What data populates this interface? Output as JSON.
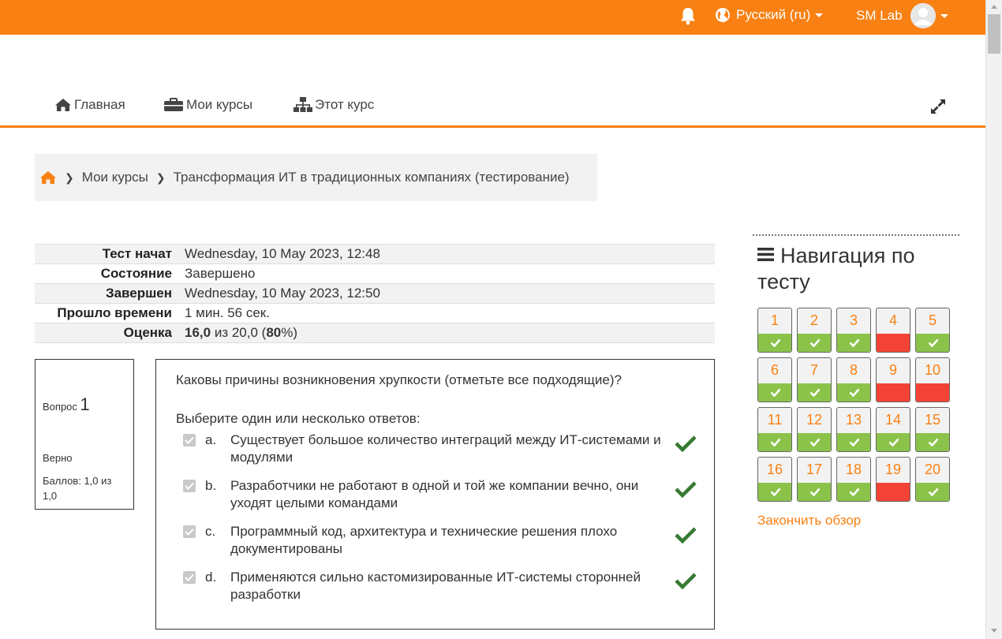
{
  "header": {
    "language": "Русский (ru)",
    "user_name": "SM Lab"
  },
  "nav": {
    "home": "Главная",
    "my_courses": "Мои курсы",
    "this_course": "Этот курс"
  },
  "breadcrumb": {
    "my_courses": "Мои курсы",
    "course": "Трансформация ИТ в традиционных компаниях (тестирование)"
  },
  "summary": {
    "started_label": "Тест начат",
    "started_value": "Wednesday, 10 May 2023, 12:48",
    "state_label": "Состояние",
    "state_value": "Завершено",
    "completed_label": "Завершен",
    "completed_value": "Wednesday, 10 May 2023, 12:50",
    "elapsed_label": "Прошло времени",
    "elapsed_value": "1 мин. 56 сек.",
    "grade_label": "Оценка",
    "grade_score": "16,0",
    "grade_rest_a": " из 20,0 (",
    "grade_percent": "80",
    "grade_rest_b": "%)"
  },
  "question": {
    "label": "Вопрос",
    "number": "1",
    "state": "Верно",
    "grade": "Баллов: 1,0 из 1,0",
    "text": "Каковы причины возникновения хрупкости (отметьте все подходящие)?",
    "prompt": "Выберите один или несколько ответов:",
    "answers": [
      {
        "letter": "a.",
        "text": "Существует большое количество интеграций между ИТ-системами и модулями"
      },
      {
        "letter": "b.",
        "text": "Разработчики не работают в одной и той же компании вечно, они уходят целыми командами"
      },
      {
        "letter": "c.",
        "text": "Программный код, архитектура и технические решения плохо документированы"
      },
      {
        "letter": "d.",
        "text": "Применяются сильно кастомизированные ИТ-системы сторонней разработки"
      }
    ]
  },
  "quiz_nav": {
    "title": "Навигация по тесту",
    "finish_review": "Закончить обзор",
    "items": [
      {
        "num": "1",
        "status": "correct"
      },
      {
        "num": "2",
        "status": "correct"
      },
      {
        "num": "3",
        "status": "correct"
      },
      {
        "num": "4",
        "status": "incorrect"
      },
      {
        "num": "5",
        "status": "correct"
      },
      {
        "num": "6",
        "status": "correct"
      },
      {
        "num": "7",
        "status": "correct"
      },
      {
        "num": "8",
        "status": "correct"
      },
      {
        "num": "9",
        "status": "incorrect"
      },
      {
        "num": "10",
        "status": "incorrect"
      },
      {
        "num": "11",
        "status": "correct"
      },
      {
        "num": "12",
        "status": "correct"
      },
      {
        "num": "13",
        "status": "correct"
      },
      {
        "num": "14",
        "status": "correct"
      },
      {
        "num": "15",
        "status": "correct"
      },
      {
        "num": "16",
        "status": "correct"
      },
      {
        "num": "17",
        "status": "correct"
      },
      {
        "num": "18",
        "status": "correct"
      },
      {
        "num": "19",
        "status": "incorrect"
      },
      {
        "num": "20",
        "status": "correct"
      }
    ]
  },
  "colors": {
    "brand": "#f98012",
    "correct": "#8bc34a",
    "incorrect": "#f44336",
    "tick": "#357a32"
  },
  "icons": {
    "bell": "bell-icon",
    "globe": "globe-icon",
    "home": "home-icon",
    "briefcase": "briefcase-icon",
    "sitemap": "sitemap-icon",
    "expand": "expand-icon",
    "menu": "menu-icon",
    "check": "check-icon"
  }
}
